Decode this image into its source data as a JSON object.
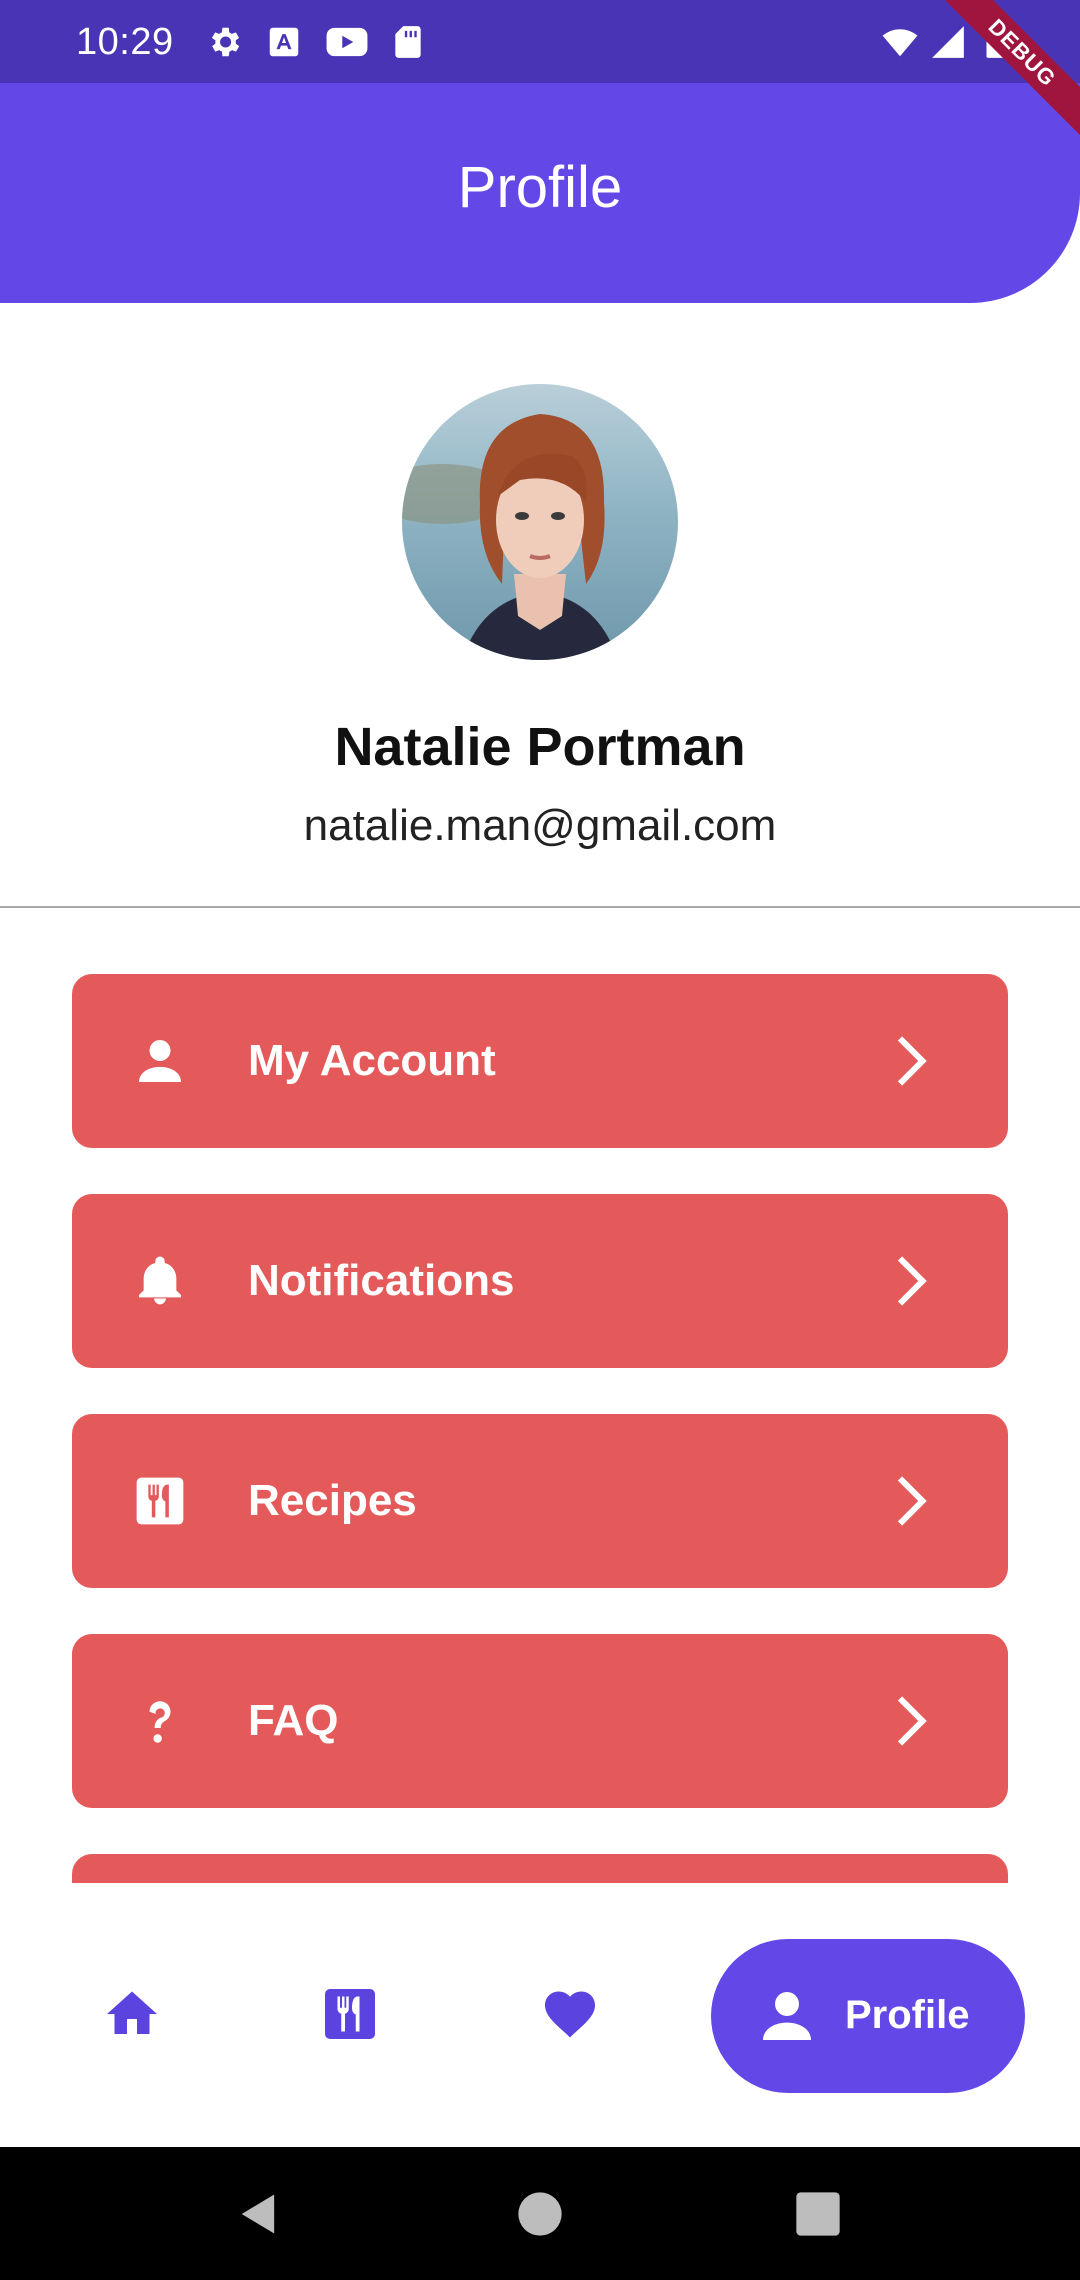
{
  "status_bar": {
    "time": "10:29",
    "left_icons": [
      "settings-icon",
      "font-a-icon",
      "youtube-icon",
      "sd-card-icon"
    ],
    "right_icons": [
      "wifi-icon",
      "signal-icon",
      "battery-icon"
    ],
    "debug_banner": "DEBUG"
  },
  "app_bar": {
    "title": "Profile",
    "color": "#6347e7"
  },
  "profile": {
    "avatar_icon": "avatar-photo",
    "name": "Natalie Portman",
    "email": "natalie.man@gmail.com"
  },
  "menu": {
    "card_color": "#e45a5a",
    "items": [
      {
        "label": "My Account",
        "icon": "person-icon"
      },
      {
        "label": "Notifications",
        "icon": "bell-icon"
      },
      {
        "label": "Recipes",
        "icon": "restaurant-menu-icon"
      },
      {
        "label": "FAQ",
        "icon": "question-icon"
      },
      {
        "label": "",
        "icon": ""
      }
    ]
  },
  "bottom_nav": {
    "items": [
      {
        "icon": "home-icon",
        "label": ""
      },
      {
        "icon": "restaurant-menu-icon",
        "label": ""
      },
      {
        "icon": "heart-icon",
        "label": ""
      }
    ],
    "active": {
      "icon": "person-icon",
      "label": "Profile"
    },
    "accent": "#5b43e0"
  },
  "system_nav": {
    "buttons": [
      "back-icon",
      "home-circle-icon",
      "recents-icon"
    ]
  }
}
